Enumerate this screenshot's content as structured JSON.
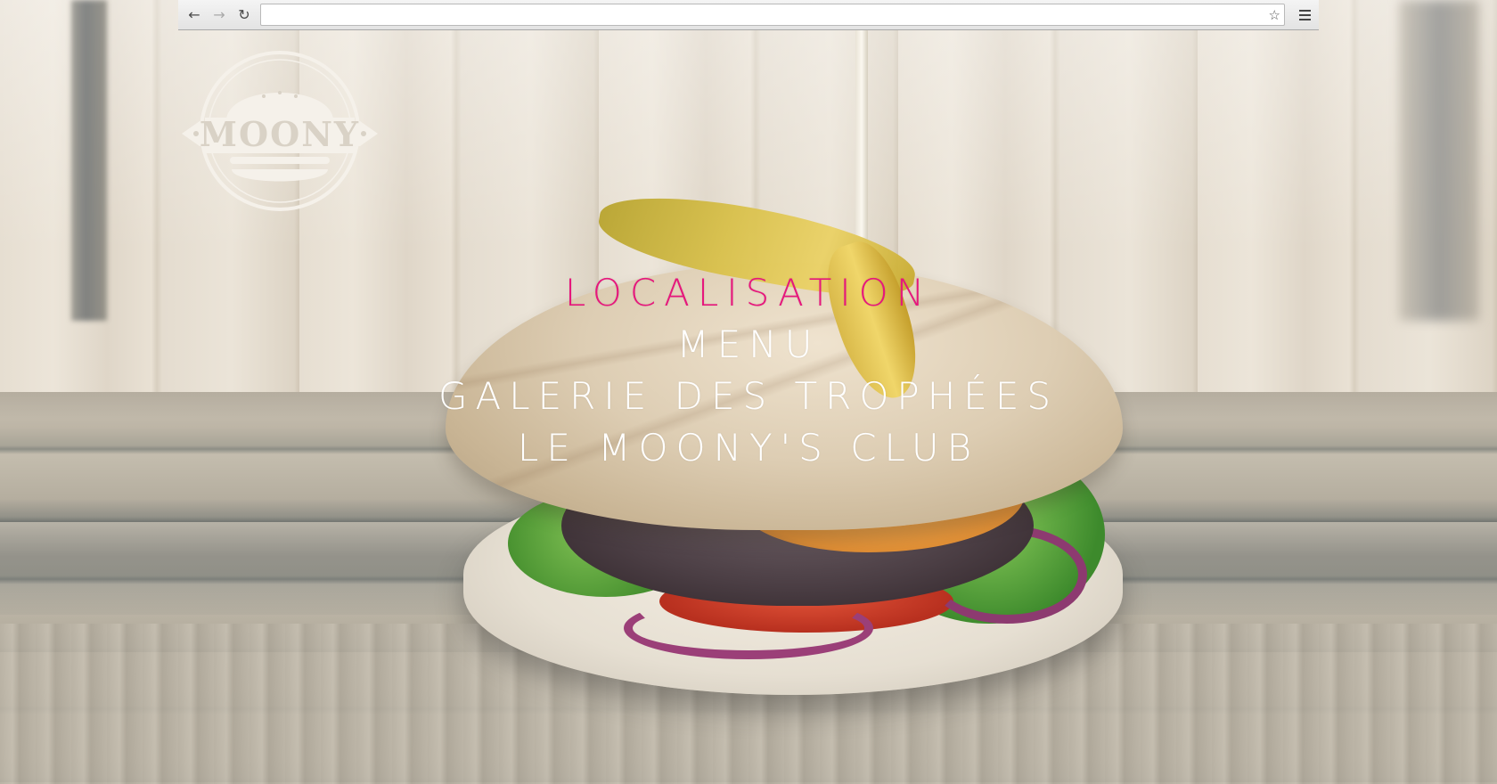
{
  "browser": {
    "url": "",
    "icons": {
      "back": "arrow-left-icon",
      "forward": "arrow-right-icon",
      "reload": "reload-icon",
      "bookmark": "star-icon",
      "menu": "hamburger-menu-icon"
    }
  },
  "logo": {
    "text": "MOONY",
    "icon": "burger-icon"
  },
  "nav": {
    "items": [
      {
        "label": "LOCALISATION",
        "active": true
      },
      {
        "label": "MENU",
        "active": false
      },
      {
        "label": "GALERIE DES TROPHÉES",
        "active": false
      },
      {
        "label": "LE MOONY'S CLUB",
        "active": false
      }
    ]
  },
  "colors": {
    "accent": "#e6177c",
    "nav_text": "#ffffff",
    "logo": "#f5f1ea"
  }
}
